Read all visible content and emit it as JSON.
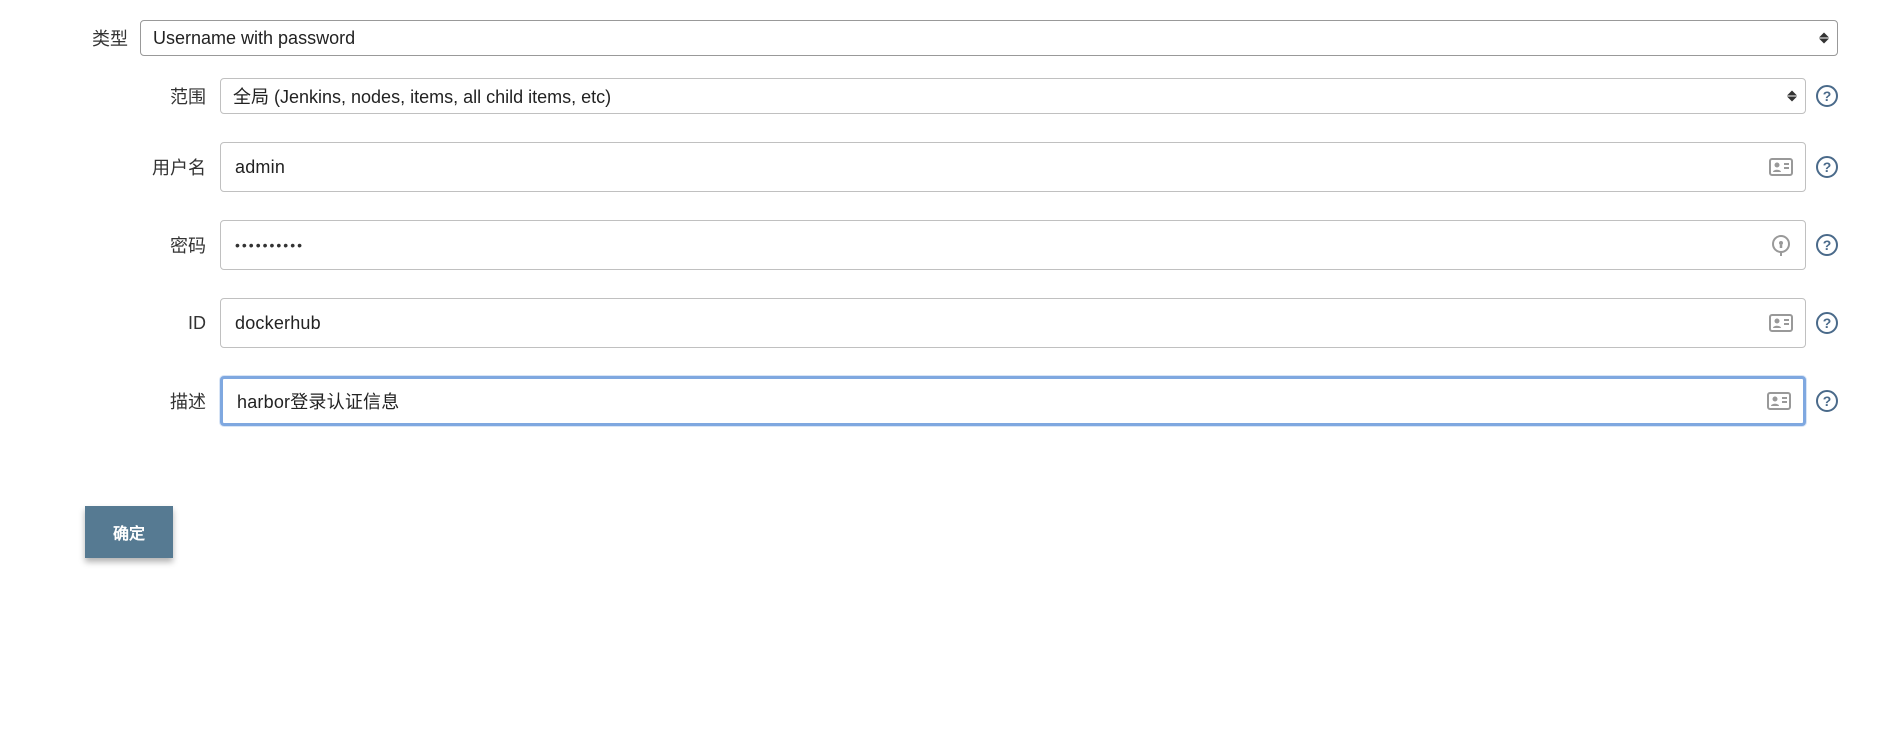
{
  "form": {
    "type_label": "类型",
    "type_value": "Username with password",
    "scope_label": "范围",
    "scope_value": "全局 (Jenkins, nodes, items, all child items, etc)",
    "username_label": "用户名",
    "username_value": "admin",
    "password_label": "密码",
    "password_value": "••••••••••",
    "id_label": "ID",
    "id_value": "dockerhub",
    "description_label": "描述",
    "description_value": "harbor登录认证信息",
    "submit_label": "确定"
  }
}
